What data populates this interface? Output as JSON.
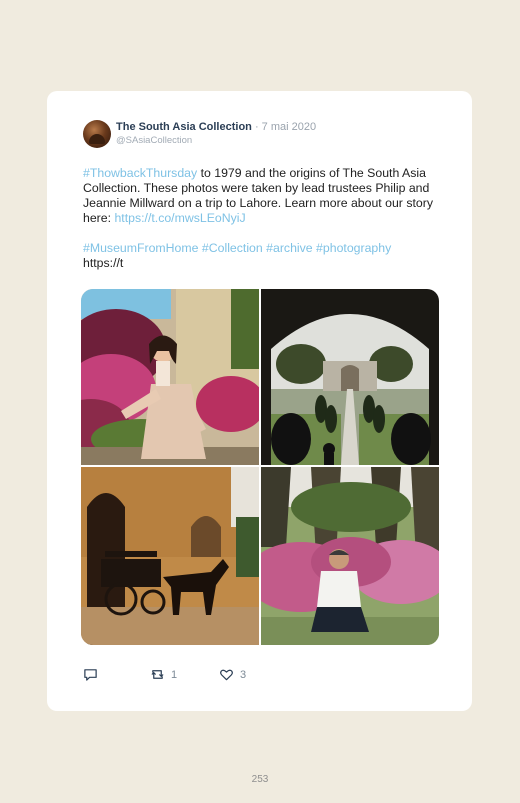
{
  "tweet": {
    "author_name": "The South Asia Collection",
    "separator": " · ",
    "date": "7 mai 2020",
    "handle": "@SAsiaCollection",
    "hashtag_throwback": "#ThowbackThursday",
    "text_body": " to 1979 and the origins of The South Asia Collection. These photos were taken by lead trustees Philip and Jeannie Millward on a trip to Lahore. Learn more about our story here: ",
    "link_url": "https://t.co/mwsLEoNyiJ",
    "hashtags": "#MuseumFromHome #Collection #archive #photography",
    "trailing_text": "https://t"
  },
  "actions": {
    "reply_count": "",
    "retweet_count": "1",
    "like_count": "3"
  },
  "page_number": "253"
}
